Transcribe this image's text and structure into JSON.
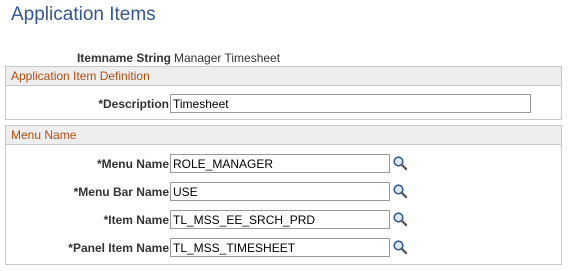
{
  "page_title": "Application Items",
  "itemname": {
    "label": "Itemname String",
    "value": "Manager Timesheet"
  },
  "definition_group": {
    "header": "Application Item Definition",
    "description_label": "*Description",
    "description_value": "Timesheet"
  },
  "menu_group": {
    "header": "Menu Name",
    "fields": [
      {
        "label": "*Menu Name",
        "value": "ROLE_MANAGER"
      },
      {
        "label": "*Menu Bar Name",
        "value": "USE"
      },
      {
        "label": "*Item Name",
        "value": "TL_MSS_EE_SRCH_PRD"
      },
      {
        "label": "*Panel Item Name",
        "value": "TL_MSS_TIMESHEET"
      }
    ],
    "lookup_icon": "magnifier-lookup-icon"
  },
  "colors": {
    "title": "#36578c",
    "group_header_text": "#b04e12",
    "group_header_bg": "#eeeeee",
    "border": "#c8c8c8"
  }
}
